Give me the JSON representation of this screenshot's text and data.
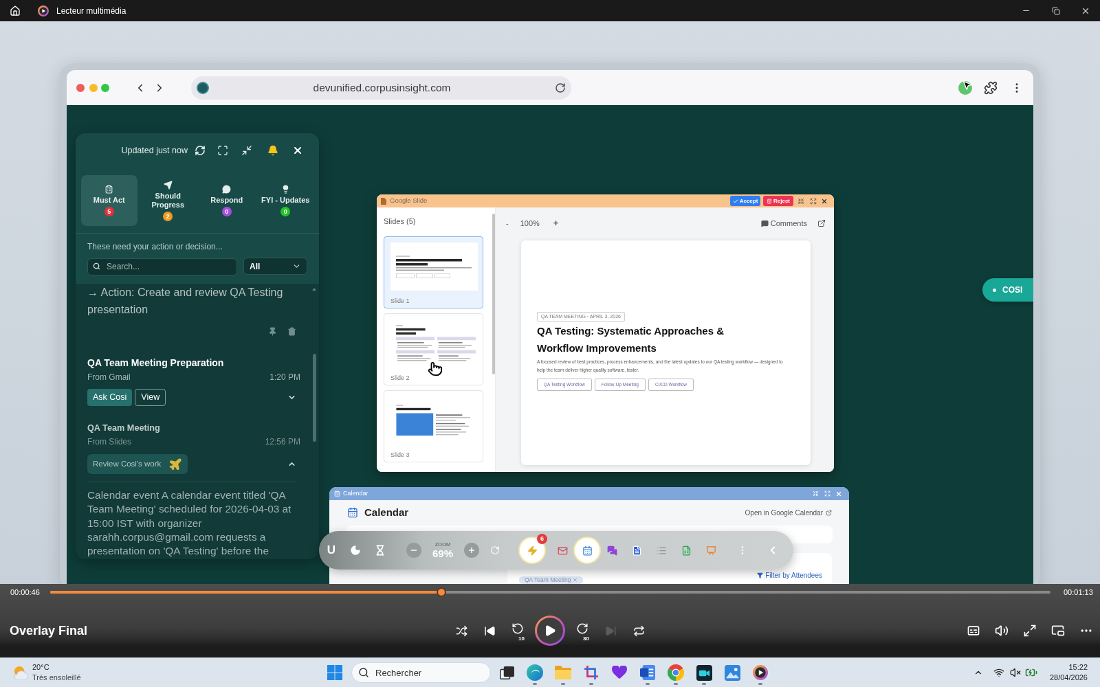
{
  "window": {
    "title": "Lecteur multimédia"
  },
  "browser": {
    "url": "devunified.corpusinsight.com"
  },
  "panel": {
    "status": "Updated just now",
    "tabs": [
      {
        "kind": "clipboard",
        "label": "Must Act",
        "count": "5",
        "color": "#e0323c",
        "selected": true
      },
      {
        "kind": "send",
        "label": "Should Progress",
        "count": "2",
        "color": "#f29a1f",
        "selected": false
      },
      {
        "kind": "chat",
        "label": "Respond",
        "count": "0",
        "color": "#a64ee0",
        "selected": false
      },
      {
        "kind": "bulb",
        "label": "FYI - Updates",
        "count": "0",
        "color": "#22c522",
        "selected": false
      }
    ],
    "hint": "These need your action or decision...",
    "search": {
      "placeholder": "Search..."
    },
    "filter": {
      "value": "All"
    },
    "action": "→ Action: Create and review QA Testing presentation",
    "items": [
      {
        "title": "QA Team Meeting Preparation",
        "source": "From Gmail",
        "time": "1:20 PM",
        "dimmed": false,
        "expanded": false,
        "buttons": [
          {
            "label": "Ask Cosi",
            "kind": "filled"
          },
          {
            "label": "View",
            "kind": "outline"
          }
        ]
      },
      {
        "title": "QA Team Meeting",
        "source": "From Slides",
        "time": "12:56 PM",
        "dimmed": true,
        "expanded": true,
        "buttons": [
          {
            "label": "Review Cosi's work",
            "kind": "review"
          }
        ],
        "description": "Calendar event A calendar event titled 'QA Team Meeting' scheduled for 2026-04-03 at 15:00 IST with organizer sarahh.corpus@gmail.com requests a presentation on 'QA Testing' before the"
      }
    ]
  },
  "cosi": {
    "label": "COSI"
  },
  "slides_window": {
    "title": "Google Slide",
    "actions": [
      {
        "label": "Accept",
        "kind": "accept"
      },
      {
        "label": "Reject",
        "kind": "reject"
      }
    ],
    "heading": "Slides (5)",
    "thumbnails": [
      {
        "label": "Slide 1",
        "kind": "title",
        "selected": true
      },
      {
        "label": "Slide 2",
        "kind": "grid",
        "selected": false
      },
      {
        "label": "Slide 3",
        "kind": "split",
        "selected": false
      }
    ],
    "zoom_out": "-",
    "zoom": "100%",
    "zoom_in": "+",
    "comments": "Comments",
    "slide": {
      "tag": "QA TEAM MEETING · APRIL 3, 2026",
      "title": "QA Testing: Systematic Approaches & Workflow Improvements",
      "text": "A focused review of best practices, process enhancements, and the latest updates to our QA testing workflow — designed to help the team deliver higher quality software, faster.",
      "tags": [
        "QA Testing Workflow",
        "Follow-Up Meeting",
        "CI/CD Workflow"
      ]
    }
  },
  "calendar_window": {
    "title": "Calendar",
    "heading": "Calendar",
    "link": "Open in Google Calendar",
    "filter": "Filter by Attendees",
    "chip": "QA Team Meeting"
  },
  "toolbar": {
    "letter": "U",
    "zoom_caption": "ZOOM",
    "zoom": "69%",
    "apps": [
      {
        "kind": "bolt",
        "selected": true,
        "badge": "6"
      },
      {
        "kind": "mail",
        "selected": false
      },
      {
        "kind": "calendar",
        "selected": true
      },
      {
        "kind": "chat",
        "selected": false
      },
      {
        "kind": "doc",
        "selected": false
      },
      {
        "kind": "list",
        "selected": false
      },
      {
        "kind": "sheet",
        "selected": false
      },
      {
        "kind": "slides",
        "selected": false
      }
    ]
  },
  "player": {
    "elapsed": "00:00:46",
    "duration": "00:01:13",
    "level": 0.391,
    "title": "Overlay Final",
    "controls": [
      {
        "kind": "shuffle",
        "disabled": false
      },
      {
        "kind": "previous",
        "disabled": false
      },
      {
        "kind": "rewind",
        "label": "10",
        "disabled": false
      },
      {
        "kind": "play",
        "disabled": false
      },
      {
        "kind": "forward",
        "label": "30",
        "disabled": false
      },
      {
        "kind": "next",
        "disabled": true
      },
      {
        "kind": "repeat",
        "disabled": false
      }
    ]
  },
  "taskbar": {
    "weather": {
      "temperature": "20°C",
      "condition": "Très ensoleillé"
    },
    "search": {
      "placeholder": "Rechercher"
    },
    "apps": [
      {
        "kind": "taskview",
        "running": false
      },
      {
        "kind": "browser",
        "running": true
      },
      {
        "kind": "folder",
        "running": true
      },
      {
        "kind": "snip",
        "running": true
      },
      {
        "kind": "heart",
        "running": false
      },
      {
        "kind": "word",
        "running": true
      },
      {
        "kind": "chrome",
        "running": true
      },
      {
        "kind": "capture",
        "running": true
      },
      {
        "kind": "photos",
        "running": false
      },
      {
        "kind": "player",
        "running": true
      }
    ],
    "clock": {
      "time": "15:22",
      "date": "28/04/2026"
    }
  }
}
